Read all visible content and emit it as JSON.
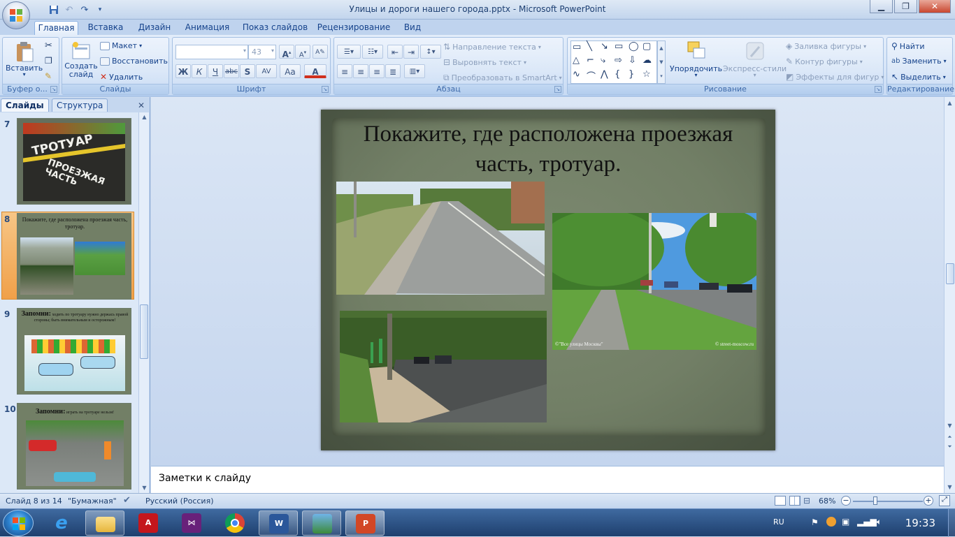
{
  "window": {
    "title": "Улицы и дороги нашего города.pptx - Microsoft PowerPoint"
  },
  "ribbon_tabs": [
    "Главная",
    "Вставка",
    "Дизайн",
    "Анимация",
    "Показ слайдов",
    "Рецензирование",
    "Вид"
  ],
  "active_tab": "Главная",
  "clipboard": {
    "paste": "Вставить",
    "label": "Буфер о..."
  },
  "slides_group": {
    "new_slide": "Создать слайд",
    "layout": "Макет",
    "reset": "Восстановить",
    "delete": "Удалить",
    "label": "Слайды"
  },
  "font_group": {
    "font_name": "",
    "font_size": "43",
    "label": "Шрифт",
    "bold": "Ж",
    "italic": "К",
    "underline": "Ч",
    "strike": "abc",
    "shadow": "S",
    "spacing": "AV",
    "case": "Aa"
  },
  "paragraph_group": {
    "text_direction": "Направление текста",
    "align_text": "Выровнять текст",
    "smartart": "Преобразовать в SmartArt",
    "label": "Абзац"
  },
  "drawing_group": {
    "arrange": "Упорядочить",
    "quick_styles": "Экспресс-стили",
    "shape_fill": "Заливка фигуры",
    "shape_outline": "Контур фигуры",
    "shape_effects": "Эффекты для фигур",
    "label": "Рисование"
  },
  "editing_group": {
    "find": "Найти",
    "replace": "Заменить",
    "select": "Выделить",
    "label": "Редактирование"
  },
  "left_panel": {
    "tab_slides": "Слайды",
    "tab_outline": "Структура"
  },
  "thumbnails": [
    {
      "num": "7",
      "title": "",
      "line1": "ТРОТУАР",
      "line2": "ПРОЕЗЖАЯ ЧАСТЬ"
    },
    {
      "num": "8",
      "title": "Покажите, где расположена проезжая часть, тротуар.",
      "selected": true
    },
    {
      "num": "9",
      "title": "Запомни:",
      "text": "ходить по тротуару нужно держась правой стороны; быть внимательным и осторожным!"
    },
    {
      "num": "10",
      "title": "Запомни:",
      "text": "играть на тротуаре нельзя!"
    }
  ],
  "slide": {
    "title": "Покажите, где расположена проезжая часть, тротуар.",
    "caption_left": "©\"Все улицы Москвы\"",
    "caption_right": "© street-moscow.ru"
  },
  "notes": {
    "placeholder": "Заметки к слайду"
  },
  "status": {
    "slide_counter": "Слайд 8 из 14",
    "theme": "\"Бумажная\"",
    "language": "Русский (Россия)",
    "zoom": "68%"
  },
  "taskbar": {
    "lang": "RU",
    "time": "19:33"
  },
  "colors": {
    "ribbon": "#d5e4f7",
    "accent": "#15428b",
    "slide_bg": "#5f6b57",
    "selection": "#f0a049"
  }
}
